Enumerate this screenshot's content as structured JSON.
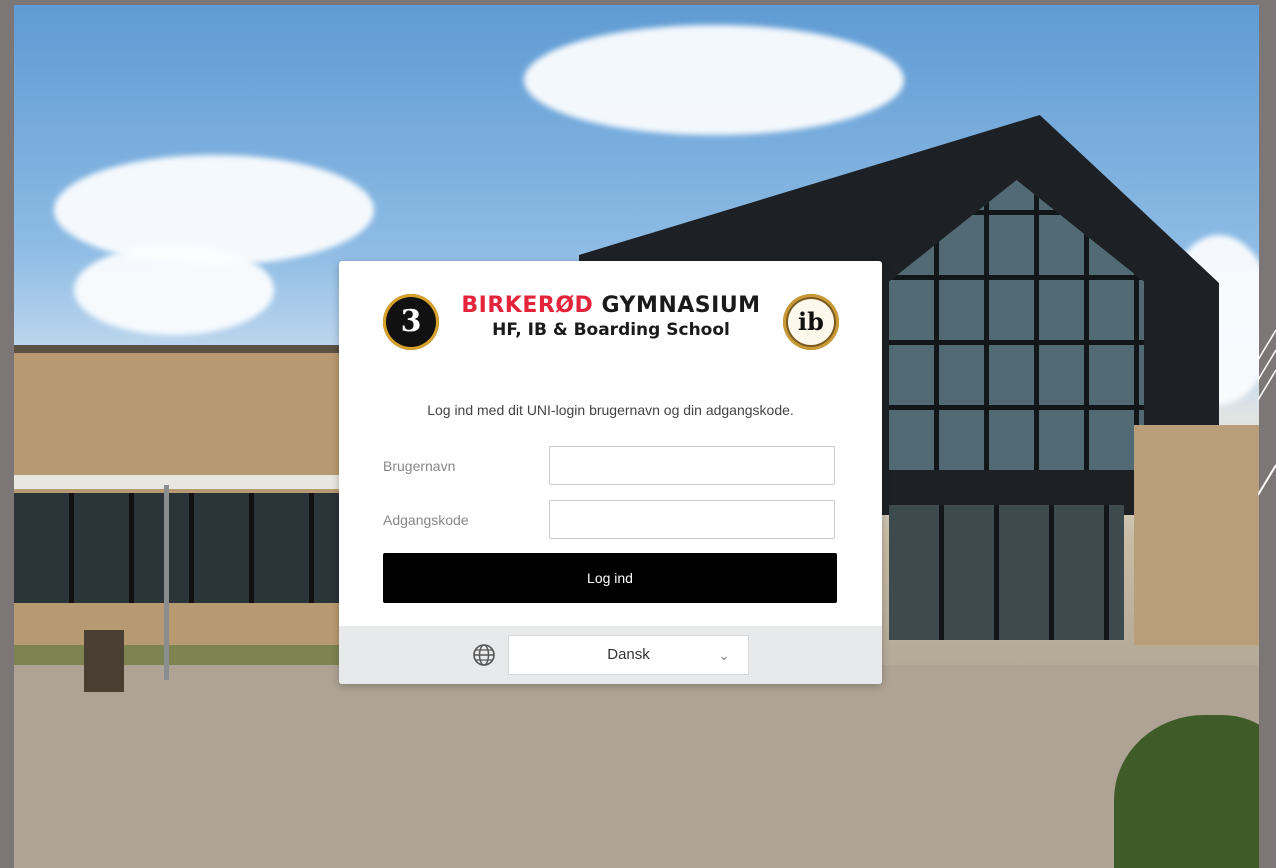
{
  "brand": {
    "name_part1": "BIRKERØD",
    "name_part2": "GYMNASIUM",
    "subtitle": "HF, IB & Boarding School",
    "left_logo_glyph": "3",
    "right_logo_glyph": "ib",
    "accent_red": "#e3243b"
  },
  "login": {
    "instructions": "Log ind med dit UNI-login brugernavn og din adgangskode.",
    "username_label": "Brugernavn",
    "password_label": "Adgangskode",
    "username_value": "",
    "password_value": "",
    "submit_label": "Log ind"
  },
  "language": {
    "icon": "globe-icon",
    "selected": "Dansk",
    "chevron": "⌄"
  }
}
